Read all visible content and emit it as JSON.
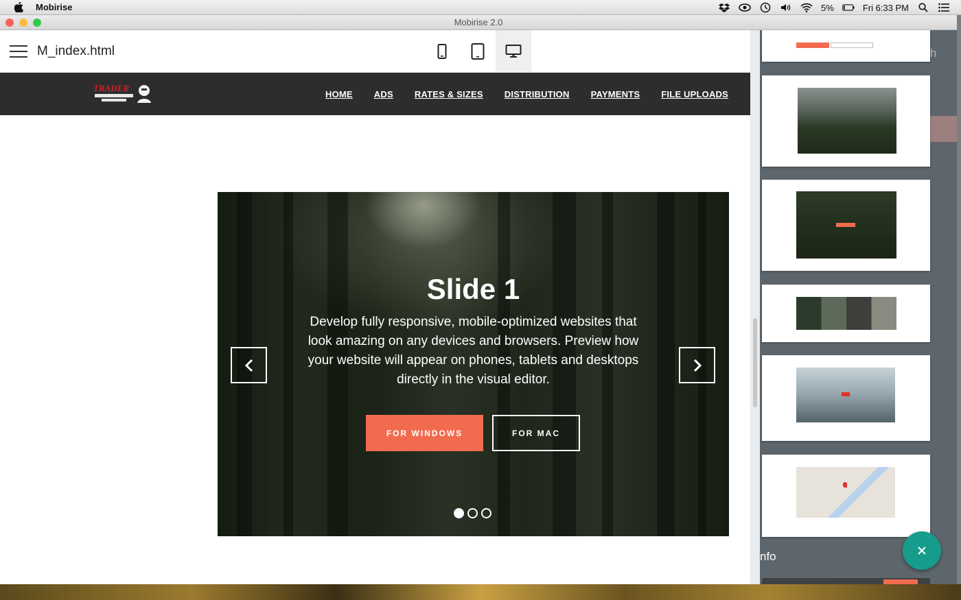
{
  "menubar": {
    "app_name": "Mobirise",
    "battery": "5%",
    "clock": "Fri 6:33 PM"
  },
  "window": {
    "title": "Mobirise 2.0"
  },
  "editor": {
    "filename": "M_index.html",
    "devices": [
      "phone-icon",
      "tablet-icon",
      "desktop-icon"
    ],
    "active_device": "desktop"
  },
  "site": {
    "logo_text": "TRADER",
    "nav": [
      "HOME",
      "ADS",
      "RATES & SIZES",
      "DISTRIBUTION",
      "PAYMENTS",
      "FILE UPLOADS"
    ]
  },
  "slider": {
    "title": "Slide 1",
    "text": "Develop fully responsive, mobile-optimized websites that look amazing on any devices and browsers. Preview how your website will appear on phones, tablets and desktops directly in the visual editor.",
    "button_primary": "FOR WINDOWS",
    "button_secondary": "FOR MAC",
    "indicator_count": 3,
    "active_indicator": 0
  },
  "panel": {
    "ghost_text": "h",
    "info_label": "nfo",
    "block_thumbnails": [
      "header-block",
      "full-screen-image",
      "slider",
      "image-gallery",
      "video-header",
      "map"
    ]
  },
  "colors": {
    "accent": "#f26b4f",
    "fab": "#169c8a",
    "navbar": "#2d2d2d",
    "panel": "#5d666c"
  }
}
